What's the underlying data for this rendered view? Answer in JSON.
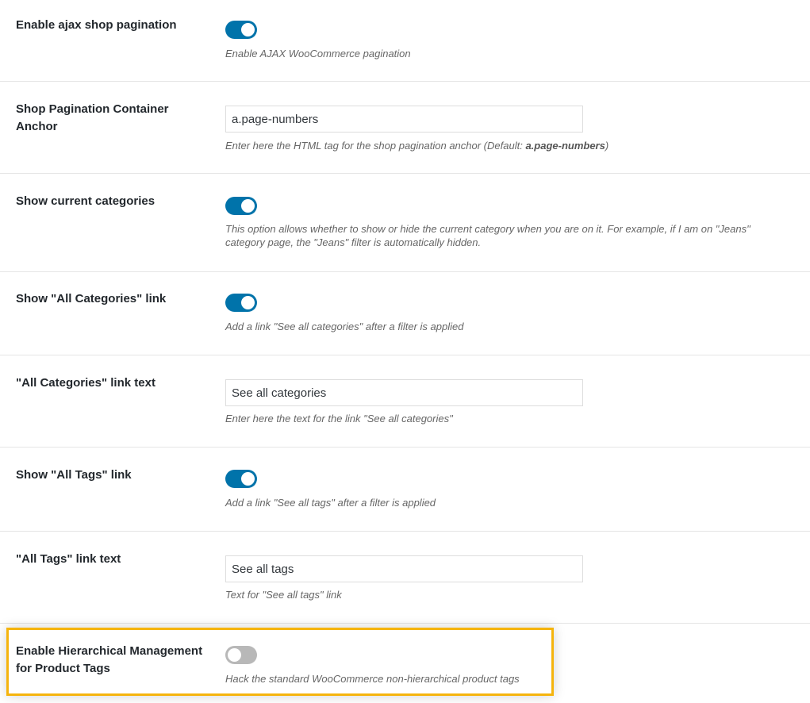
{
  "colors": {
    "toggle_on": "#0073aa",
    "toggle_off": "#b8b8b8",
    "highlight": "#f5b40d"
  },
  "settings": {
    "ajax_pagination": {
      "label": "Enable ajax shop pagination",
      "enabled": true,
      "description": "Enable AJAX WooCommerce pagination"
    },
    "pagination_anchor": {
      "label": "Shop Pagination Container Anchor",
      "value": "a.page-numbers",
      "description_prefix": "Enter here the HTML tag for the shop pagination anchor (Default: ",
      "description_default": "a.page-numbers",
      "description_suffix": ")"
    },
    "current_categories": {
      "label": "Show current categories",
      "enabled": true,
      "description": "This option allows whether to show or hide the current category when you are on it. For example, if I am on \"Jeans\" category page, the \"Jeans\" filter is automatically hidden."
    },
    "all_categories_link": {
      "label": "Show \"All Categories\" link",
      "enabled": true,
      "description": "Add a link \"See all categories\" after a filter is applied"
    },
    "all_categories_text": {
      "label": "\"All Categories\" link text",
      "value": "See all categories",
      "description": "Enter here the text for the link \"See all categories\""
    },
    "all_tags_link": {
      "label": "Show \"All Tags\" link",
      "enabled": true,
      "description": "Add a link \"See all tags\" after a filter is applied"
    },
    "all_tags_text": {
      "label": "\"All Tags\" link text",
      "value": "See all tags",
      "description": "Text for \"See all tags\" link"
    },
    "hierarchical_tags": {
      "label": "Enable Hierarchical Management for Product Tags",
      "enabled": false,
      "description": "Hack the standard WooCommerce non-hierarchical product tags"
    }
  }
}
